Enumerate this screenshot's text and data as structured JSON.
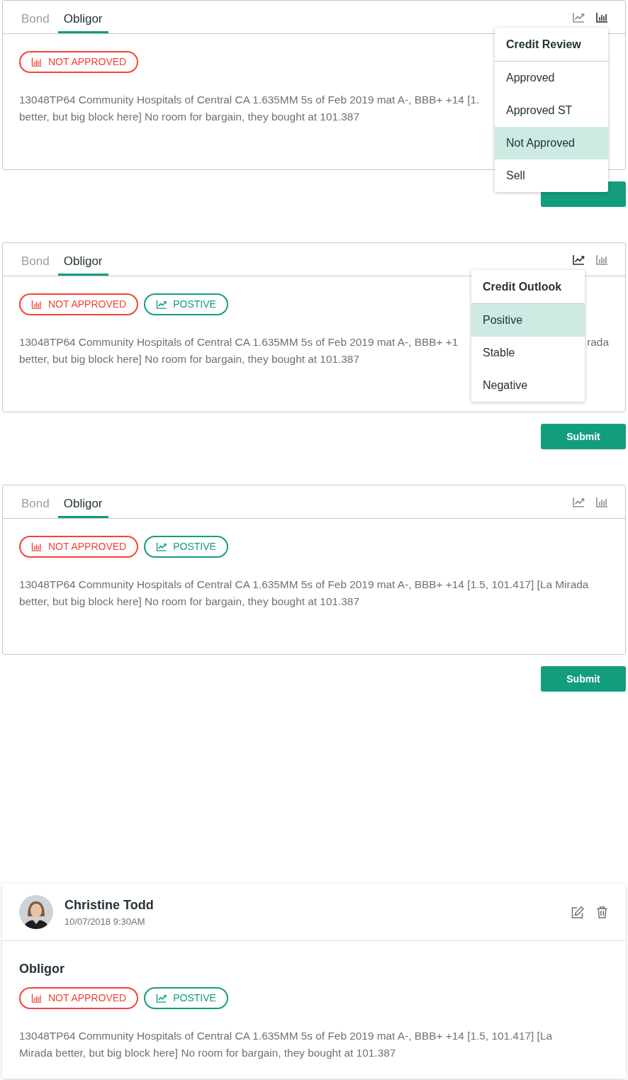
{
  "panels": [
    {
      "tabs": [
        {
          "label": "Bond",
          "selected": false
        },
        {
          "label": "Obligor",
          "selected": true
        }
      ],
      "tools": [
        {
          "kind": "trend",
          "selected": false
        },
        {
          "kind": "bars",
          "selected": true
        }
      ],
      "tags": [
        {
          "kind": "review",
          "label": "NOT APPROVED",
          "color": "#f44336"
        }
      ],
      "note_lines": [
        [
          "13048TP64 Community Hospitals of Central CA 1.635MM 5s of Feb 2019 mat A-, BBB+ +14 [1."
        ],
        [
          "better, but big block here] No room for bargain, they bought at 101.387"
        ]
      ],
      "menu": {
        "title": "Credit Review",
        "items": [
          {
            "label": "Approved",
            "selected": false
          },
          {
            "label": "Approved ST",
            "selected": false
          },
          {
            "label": "Not Approved",
            "selected": true
          },
          {
            "label": "Sell",
            "selected": false
          }
        ]
      },
      "submit": {
        "kind": "covered"
      }
    },
    {
      "tabs": [
        {
          "label": "Bond",
          "selected": false
        },
        {
          "label": "Obligor",
          "selected": true
        }
      ],
      "tools": [
        {
          "kind": "trend",
          "selected": true
        },
        {
          "kind": "bars",
          "selected": false
        }
      ],
      "tags": [
        {
          "kind": "review",
          "label": "NOT APPROVED",
          "color": "#f44336"
        },
        {
          "kind": "outlook",
          "label": "POSTIVE",
          "color": "#129d7f"
        }
      ],
      "note_lines": [
        [
          "13048TP64 Community Hospitals of Central CA 1.635MM 5s of Feb 2019 mat A-, BBB+ +1",
          "rada"
        ],
        [
          "better, but big block here] No room for bargain, they bought at 101.387"
        ]
      ],
      "menu": {
        "title": "Credit Outlook",
        "items": [
          {
            "label": "Positive",
            "selected": true
          },
          {
            "label": "Stable",
            "selected": false
          },
          {
            "label": "Negative",
            "selected": false
          }
        ]
      },
      "submit": {
        "kind": "shown",
        "label": "Submit"
      }
    },
    {
      "tabs": [
        {
          "label": "Bond",
          "selected": false
        },
        {
          "label": "Obligor",
          "selected": true
        }
      ],
      "tools": [
        {
          "kind": "trend",
          "selected": false
        },
        {
          "kind": "bars",
          "selected": false
        }
      ],
      "tags": [
        {
          "kind": "review",
          "label": "NOT APPROVED",
          "color": "#f44336"
        },
        {
          "kind": "outlook",
          "label": "POSTIVE",
          "color": "#129d7f"
        }
      ],
      "note_lines": [
        [
          "13048TP64 Community Hospitals of Central CA 1.635MM 5s of Feb 2019 mat A-, BBB+ +14 [1.5, 101.417] [La Mirada"
        ],
        [
          "better, but big block here] No room for bargain, they bought at 101.387"
        ]
      ],
      "submit": {
        "kind": "shown",
        "label": "Submit"
      }
    }
  ],
  "comment": {
    "author": "Christine Todd",
    "timestamp": "10/07/2018 9:30AM",
    "actions": [
      {
        "kind": "edit"
      },
      {
        "kind": "delete"
      }
    ],
    "section": "Obligor",
    "tags": [
      {
        "kind": "review",
        "label": "NOT APPROVED",
        "color": "#f44336"
      },
      {
        "kind": "outlook",
        "label": "POSTIVE",
        "color": "#129d7f"
      }
    ],
    "note_lines": [
      [
        "13048TP64 Community Hospitals of Central CA 1.635MM 5s of Feb 2019 mat A-, BBB+ +14 [1.5, 101.417] [La"
      ],
      [
        "Mirada better, but big block here] No room for bargain, they bought at 101.387"
      ]
    ]
  }
}
